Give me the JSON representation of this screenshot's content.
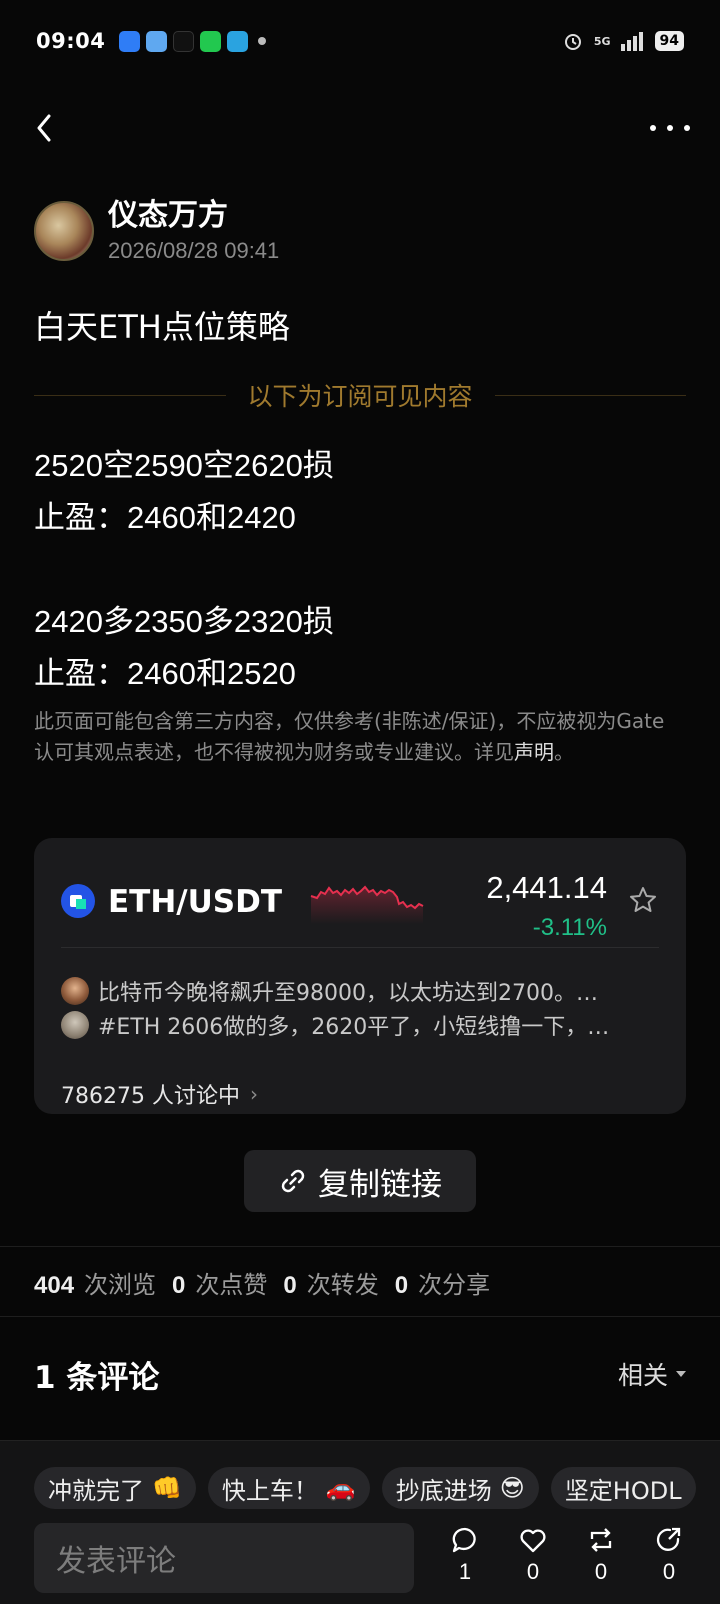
{
  "status_bar": {
    "time": "09:04",
    "network": "5G",
    "battery": "94"
  },
  "author": {
    "name": "仪态万方",
    "time": "2026/08/28 09:41"
  },
  "post": {
    "title": "白天ETH点位策略",
    "subscriber_divider": "以下为订阅可见内容",
    "lines": [
      "2520空2590空2620损",
      "止盈：2460和2420",
      "",
      "2420多2350多2320损",
      "止盈：2460和2520"
    ],
    "disclaimer_text": "此页面可能包含第三方内容，仅供参考(非陈述/保证)，不应被视为Gate认可其观点表述，也不得被视为财务或专业建议。详见",
    "disclaimer_link": "声明",
    "disclaimer_end": "。"
  },
  "market_card": {
    "pair": "ETH/USDT",
    "price": "2,441.14",
    "change": "-3.11%",
    "colors": {
      "down": "#e6304f",
      "up": "#20c088"
    },
    "posts": [
      "比特币今晚将飙升至98000，以太坊达到2700。…",
      "#ETH 2606做的多，2620平了，小短线撸一下，…"
    ],
    "discussing": "786275 人讨论中"
  },
  "copy_link": {
    "label": "复制链接",
    "icon": "link-icon"
  },
  "stats": [
    {
      "num": "404",
      "label": "次浏览"
    },
    {
      "num": "0",
      "label": "次点赞"
    },
    {
      "num": "0",
      "label": "次转发"
    },
    {
      "num": "0",
      "label": "次分享"
    }
  ],
  "comments": {
    "title": "1 条评论",
    "sort": "相关"
  },
  "quick_replies": [
    {
      "text": "冲就完了",
      "emoji": "👊"
    },
    {
      "text": "快上车！",
      "emoji": "🚗"
    },
    {
      "text": "抄底进场",
      "emoji": "😎"
    },
    {
      "text": "坚定HODL",
      "emoji": ""
    }
  ],
  "composer": {
    "placeholder": "发表评论"
  },
  "actions": [
    {
      "icon": "comment-icon",
      "count": "1"
    },
    {
      "icon": "like-icon",
      "count": "0"
    },
    {
      "icon": "repost-icon",
      "count": "0"
    },
    {
      "icon": "share-icon",
      "count": "0"
    }
  ]
}
